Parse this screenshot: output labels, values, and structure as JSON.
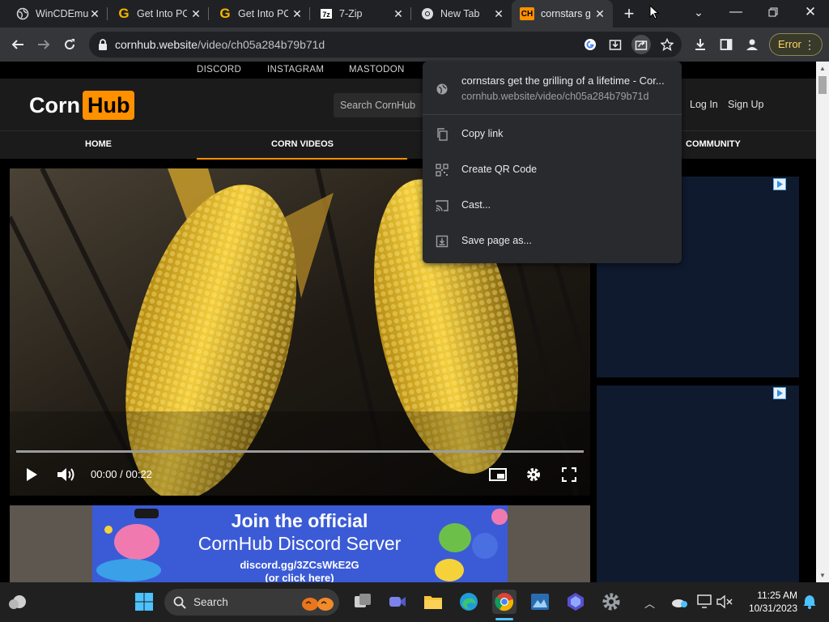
{
  "tabs": [
    {
      "title": "WinCDEmu",
      "icon": "globe-icon"
    },
    {
      "title": "Get Into PC",
      "icon": "g-favicon-icon"
    },
    {
      "title": "Get Into PC",
      "icon": "g-favicon-icon"
    },
    {
      "title": "7-Zip",
      "icon": "seven-zip-icon"
    },
    {
      "title": "New Tab",
      "icon": "chrome-icon"
    },
    {
      "title": "cornstars g",
      "icon": "ch-favicon-icon",
      "active": true
    }
  ],
  "toolbar": {
    "url_host": "cornhub.website",
    "url_path": "/video/ch05a284b79b71d",
    "error_label": "Error"
  },
  "site": {
    "social": [
      "DISCORD",
      "INSTAGRAM",
      "MASTODON"
    ],
    "logo_left": "Corn",
    "logo_right": "Hub",
    "search_placeholder": "Search CornHub",
    "login": "Log In",
    "signup": "Sign Up",
    "nav": [
      "HOME",
      "CORN VIDEOS",
      "COMMUNITY"
    ],
    "brand_color": "#ff9000"
  },
  "video": {
    "time": "00:00 / 00:22",
    "progress": 0
  },
  "banner": {
    "line1": "Join the official",
    "line2": "CornHub Discord Server",
    "line3": "discord.gg/3ZCsWkE2G",
    "line4": "(or click here)"
  },
  "share_menu": {
    "title": "cornstars get the grilling of a lifetime - Cor...",
    "url": "cornhub.website/video/ch05a284b79b71d",
    "items": [
      "Copy link",
      "Create QR Code",
      "Cast...",
      "Save page as..."
    ]
  },
  "taskbar": {
    "search_label": "Search",
    "time": "11:25 AM",
    "date": "10/31/2023"
  }
}
